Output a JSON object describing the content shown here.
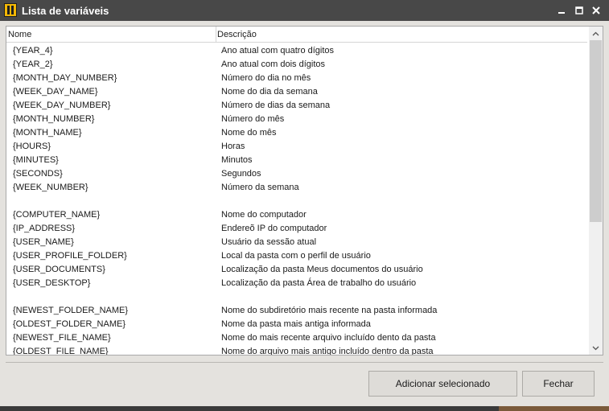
{
  "window": {
    "title": "Lista de variáveis",
    "icon": "app-logo-icon",
    "controls": {
      "minimize": "minimize-icon",
      "maximize": "maximize-icon",
      "close": "close-icon"
    }
  },
  "list": {
    "columns": {
      "name": "Nome",
      "description": "Descrição"
    },
    "rows": [
      {
        "name": "{YEAR_4}",
        "description": "Ano atual com quatro dígitos"
      },
      {
        "name": "{YEAR_2}",
        "description": "Ano atual com dois dígitos"
      },
      {
        "name": "{MONTH_DAY_NUMBER}",
        "description": "Número do dia no mês"
      },
      {
        "name": "{WEEK_DAY_NAME}",
        "description": "Nome do dia da semana"
      },
      {
        "name": "{WEEK_DAY_NUMBER}",
        "description": "Número de dias da semana"
      },
      {
        "name": "{MONTH_NUMBER}",
        "description": "Número do mês"
      },
      {
        "name": "{MONTH_NAME}",
        "description": "Nome do mês"
      },
      {
        "name": "{HOURS}",
        "description": "Horas"
      },
      {
        "name": "{MINUTES}",
        "description": "Minutos"
      },
      {
        "name": "{SECONDS}",
        "description": "Segundos"
      },
      {
        "name": "{WEEK_NUMBER}",
        "description": "Número da semana"
      },
      {
        "name": "",
        "description": ""
      },
      {
        "name": "{COMPUTER_NAME}",
        "description": "Nome do computador"
      },
      {
        "name": "{IP_ADDRESS}",
        "description": "Endereõ IP do computador"
      },
      {
        "name": "{USER_NAME}",
        "description": "Usuário da sessão atual"
      },
      {
        "name": "{USER_PROFILE_FOLDER}",
        "description": "Local da pasta com o perfil de usuário"
      },
      {
        "name": "{USER_DOCUMENTS}",
        "description": "Localização da pasta Meus documentos do usuário"
      },
      {
        "name": "{USER_DESKTOP}",
        "description": "Localização da pasta Área de trabalho do usuário"
      },
      {
        "name": "",
        "description": ""
      },
      {
        "name": "{NEWEST_FOLDER_NAME}",
        "description": "Nome do subdiretório mais recente na pasta informada"
      },
      {
        "name": "{OLDEST_FOLDER_NAME}",
        "description": "Nome da pasta mais antiga informada"
      },
      {
        "name": "{NEWEST_FILE_NAME}",
        "description": "Nome do mais recente arquivo incluído dento da pasta"
      },
      {
        "name": "{OLDEST_FILE_NAME}",
        "description": "Nome do arquivo mais antigo incluído dentro da pasta"
      }
    ]
  },
  "buttons": {
    "add_selected": "Adicionar selecionado",
    "close": "Fechar"
  },
  "colors": {
    "titlebar": "#484848",
    "window_bg": "#e4e2de",
    "list_bg": "#ffffff",
    "accent_logo": "#f2b705"
  }
}
